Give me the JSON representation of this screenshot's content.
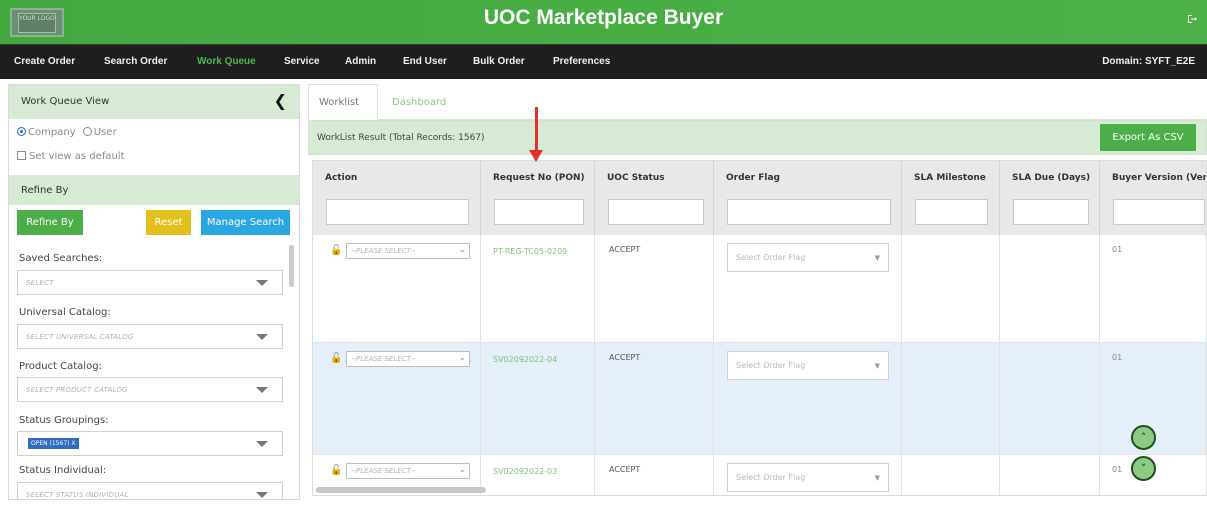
{
  "header": {
    "logo_text": "YOUR LOGO",
    "title": "UOC Marketplace Buyer",
    "logout_icon": "logout-icon"
  },
  "nav": {
    "items": [
      "Create Order",
      "Search Order",
      "Work Queue",
      "Service",
      "Admin",
      "End User",
      "Bulk Order",
      "Preferences"
    ],
    "active": "Work Queue",
    "domain": "Domain: SYFT_E2E"
  },
  "sidebar": {
    "title": "Work Queue View",
    "view_options": [
      "Company",
      "User"
    ],
    "view_selected": "Company",
    "set_default_label": "Set view as default",
    "refine_title": "Refine By",
    "buttons": {
      "refine": "Refine By",
      "reset": "Reset",
      "manage": "Manage Search"
    },
    "fields": [
      {
        "label": "Saved Searches:",
        "placeholder": "SELECT"
      },
      {
        "label": "Universal Catalog:",
        "placeholder": "SELECT UNIVERSAL CATALOG"
      },
      {
        "label": "Product Catalog:",
        "placeholder": "SELECT PRODUCT CATALOG"
      },
      {
        "label": "Status Groupings:",
        "chip": "OPEN (1567) X"
      },
      {
        "label": "Status Individual:",
        "placeholder": "SELECT STATUS INDIVIDUAL"
      }
    ]
  },
  "main": {
    "tabs": [
      "Worklist",
      "Dashboard"
    ],
    "active_tab": "Worklist",
    "result_text": "WorkList Result (Total Records: 1567)",
    "export_label": "Export As CSV",
    "columns": [
      "Action",
      "Request No (PON)",
      "UOC Status",
      "Order Flag",
      "SLA Milestone",
      "SLA Due (Days)",
      "Buyer Version (Ver"
    ],
    "rows": [
      {
        "action": "--PLEASE SELECT--",
        "pon": "PT-REG-TC05-0209",
        "status": "ACCEPT",
        "flag": "Select Order Flag",
        "sla_milestone": "",
        "sla_due": "",
        "version": "01"
      },
      {
        "action": "--PLEASE SELECT--",
        "pon": "SV02092022-04",
        "status": "ACCEPT",
        "flag": "Select Order Flag",
        "sla_milestone": "",
        "sla_due": "",
        "version": "01"
      },
      {
        "action": "--PLEASE SELECT--",
        "pon": "SV02092022-03",
        "status": "ACCEPT",
        "flag": "Select Order Flag",
        "sla_milestone": "",
        "sla_due": "",
        "version": "01"
      }
    ]
  },
  "icons": {
    "collapse": "chevron-left-icon",
    "lock": "unlock-icon",
    "scroll_up": "chevron-up-circle-icon",
    "scroll_down": "chevron-down-circle-icon"
  },
  "colors": {
    "brand_green": "#4bae48",
    "nav_bg": "#1e1e1e",
    "reset_yellow": "#e2c01c",
    "manage_blue": "#29a7e0",
    "annotation_red": "#e03030"
  }
}
